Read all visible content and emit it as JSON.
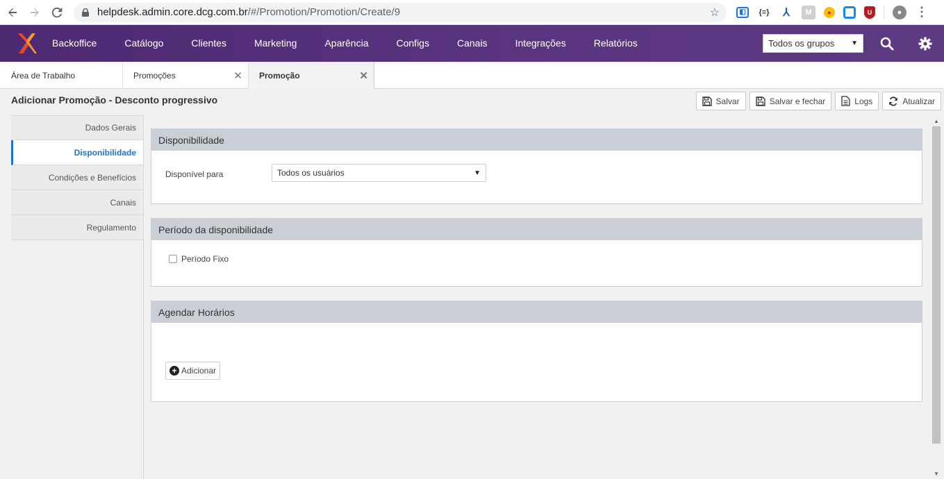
{
  "browser": {
    "url_main": "helpdesk.admin.core.dcg.com.br",
    "url_path": "/#/Promotion/Promotion/Create/9"
  },
  "header": {
    "menu": [
      "Backoffice",
      "Catálogo",
      "Clientes",
      "Marketing",
      "Aparência",
      "Configs",
      "Canais",
      "Integrações",
      "Relatórios"
    ],
    "group_select": "Todos os grupos"
  },
  "tabs": {
    "t1": "Área de Trabalho",
    "t2": "Promoções",
    "t3": "Promoção"
  },
  "page": {
    "title": "Adicionar Promoção - Desconto progressivo"
  },
  "actions": {
    "save": "Salvar",
    "save_close": "Salvar e fechar",
    "logs": "Logs",
    "refresh": "Atualizar"
  },
  "leftnav": {
    "items": [
      "Dados Gerais",
      "Disponibilidade",
      "Condições e Benefícios",
      "Canais",
      "Regulamento"
    ],
    "active": "Disponibilidade"
  },
  "panels": {
    "availability": {
      "title": "Disponibilidade",
      "label": "Disponível para",
      "value": "Todos os usuários"
    },
    "period": {
      "title": "Período da disponibilidade",
      "checkbox_label": "Período Fixo"
    },
    "schedule": {
      "title": "Agendar Horários",
      "add_label": "Adicionar"
    }
  },
  "colors": {
    "header_bg": "#552f7a",
    "active_link": "#1e73c8",
    "panel_head": "#c9cfd5"
  }
}
